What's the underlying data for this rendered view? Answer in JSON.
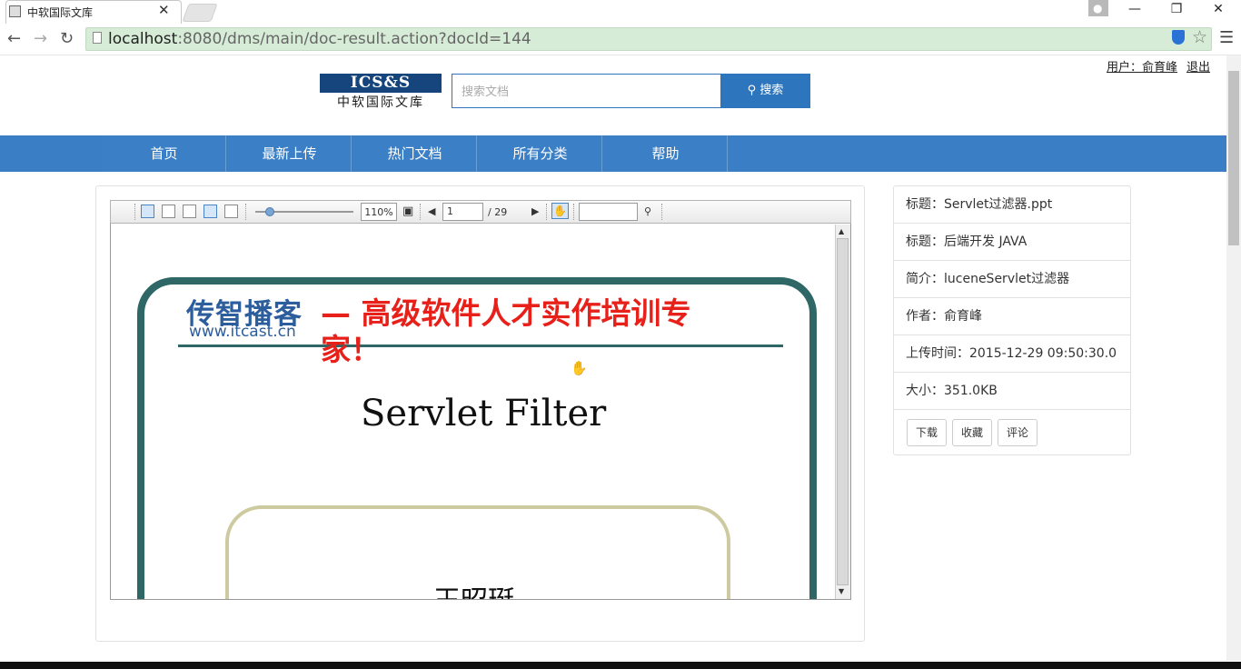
{
  "browser": {
    "tab_title": "中软国际文库",
    "tab_close": "✕",
    "url_host": "localhost",
    "url_rest": ":8080/dms/main/doc-result.action?docId=144",
    "window_buttons": {
      "minimize": "—",
      "restore": "❐",
      "close": "✕"
    }
  },
  "header": {
    "user_label": "用户：俞育峰",
    "logout_label": "退出",
    "logo_top": "ICS&S",
    "logo_bottom": "中软国际文库",
    "search_placeholder": "搜索文档",
    "search_button": "搜索"
  },
  "nav": {
    "items": [
      "首页",
      "最新上传",
      "热门文档",
      "所有分类",
      "帮助"
    ],
    "color": "#3a7fc6"
  },
  "viewer": {
    "zoom": "110%",
    "current_page": "1",
    "total_pages": "/ 29"
  },
  "slide": {
    "logo_cn": "传智播客",
    "logo_en": "www.itcast.cn",
    "slogan": "— 高级软件人才实作培训专家！",
    "title": "Servlet Filter",
    "author": "王昭珽"
  },
  "doc_info": {
    "title": "标题：Servlet过滤器.ppt",
    "category": "标题：后端开发 JAVA",
    "summary": "简介：luceneServlet过滤器",
    "author": "作者：俞育峰",
    "upload_time": "上传时间：2015-12-29 09:50:30.0",
    "size": "大小：351.0KB",
    "buttons": {
      "download": "下载",
      "favorite": "收藏",
      "comment": "评论"
    }
  }
}
